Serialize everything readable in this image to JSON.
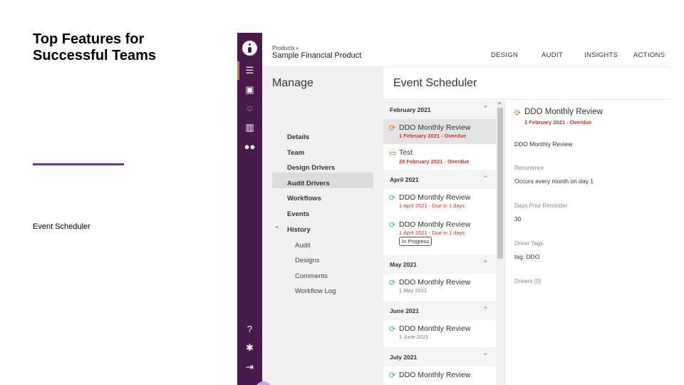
{
  "slide": {
    "title_line1": "Top Features for",
    "title_line2": "Successful Teams",
    "caption": "Event Scheduler",
    "accent_color": "#6f2da8"
  },
  "app": {
    "rail_color": "#4a1a4e",
    "rail_icons_top": [
      "logo-icon",
      "list-icon",
      "calendar-check-icon",
      "chat-icon",
      "chart-icon",
      "people-icon"
    ],
    "rail_icons_bottom": [
      "help-icon",
      "gear-icon",
      "logout-icon"
    ]
  },
  "topbar": {
    "breadcrumb": "Products",
    "product_name": "Sample Financial Product",
    "nav": [
      "DESIGN",
      "AUDIT",
      "INSIGHTS",
      "ACTIONS"
    ]
  },
  "manage": {
    "title": "Manage",
    "items": [
      "Details",
      "Team",
      "Design Drivers",
      "Audit Drivers",
      "Workflows",
      "Events",
      "History"
    ],
    "history_items": [
      "Audit",
      "Designs",
      "Comments",
      "Workflow Log"
    ],
    "selected": "Events"
  },
  "scheduler": {
    "title": "Event Scheduler",
    "months": [
      {
        "label": "February 2021"
      },
      {
        "label": "April 2021"
      },
      {
        "label": "May 2021"
      },
      {
        "label": "June 2021"
      },
      {
        "label": "July 2021"
      }
    ],
    "events": [
      {
        "title": "DDO Monthly Review",
        "sub": "1 February 2021 - Overdue",
        "status": "overdue",
        "icon": "recurring-icon",
        "selected": true
      },
      {
        "title": "Test",
        "sub": "28 February 2021 - Overdue",
        "status": "overdue",
        "icon": "calendar-icon"
      },
      {
        "title": "DDO Monthly Review",
        "sub": "1 April 2021 - Due in 1 days",
        "status": "due",
        "icon": "recurring-icon"
      },
      {
        "title": "DDO Monthly Review",
        "sub": "1 April 2021 - Due in 1 days",
        "status": "due",
        "icon": "recurring-icon",
        "badge": "In Progress"
      },
      {
        "title": "DDO Monthly Review",
        "sub": "1 May 2021",
        "status": "future",
        "icon": "recurring-icon"
      },
      {
        "title": "DDO Monthly Review",
        "sub": "1 June 2021",
        "status": "future",
        "icon": "recurring-icon"
      },
      {
        "title": "DDO Monthly Review",
        "sub": "",
        "status": "future",
        "icon": "recurring-icon"
      }
    ]
  },
  "detail": {
    "title": "DDO Monthly Review",
    "date": "1 February 2021 - Overdue",
    "description": "DDO Monthly Review",
    "recurrence_label": "Recurrence",
    "recurrence_value": "Occurs every month on day 1",
    "reminder_label": "Days Prior Reminder",
    "reminder_value": "30",
    "tags_label": "Driver Tags",
    "tags_value": "tag: DDO",
    "drivers_label": "Drivers (0)"
  }
}
